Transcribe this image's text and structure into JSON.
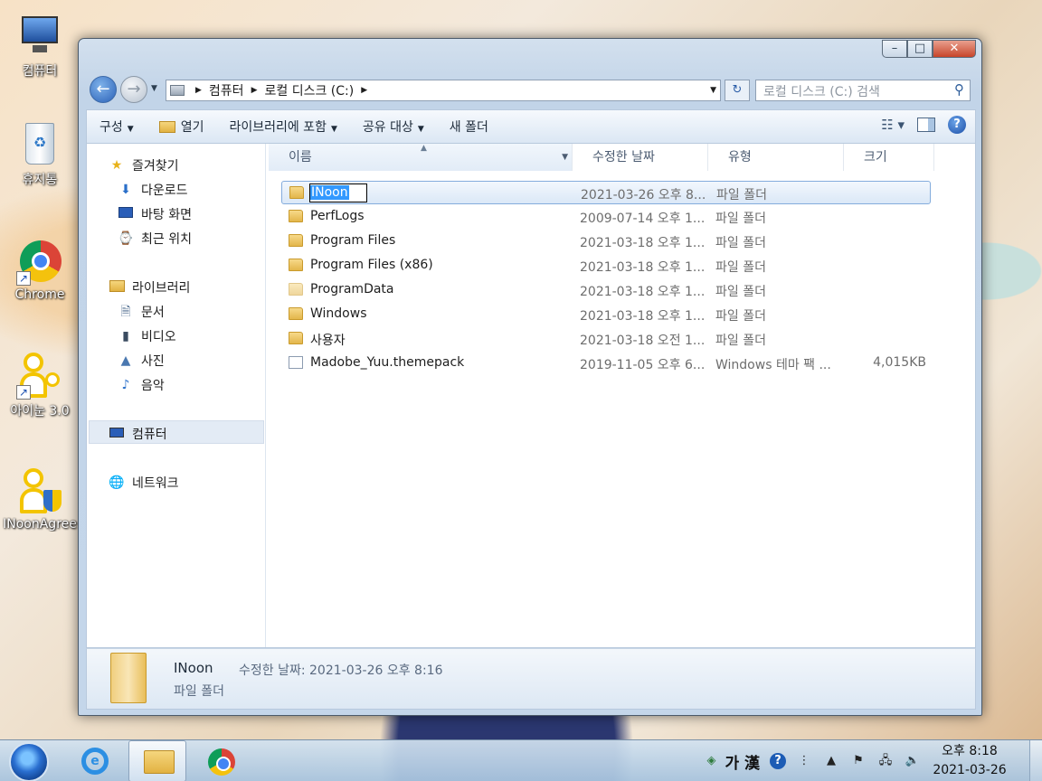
{
  "desktop": {
    "icons": [
      {
        "label": "컴퓨터",
        "icon": "computer-icon"
      },
      {
        "label": "휴지통",
        "icon": "recycle-bin-icon"
      },
      {
        "label": "Chrome",
        "icon": "chrome-icon"
      },
      {
        "label": "아이눈 3.0",
        "icon": "inoon-icon"
      },
      {
        "label": "INoonAgree",
        "icon": "inoon-agree-icon"
      }
    ]
  },
  "window": {
    "caption": {
      "minimize": "–",
      "maximize": "□",
      "close": "✕"
    },
    "address": {
      "crumbs": [
        "컴퓨터",
        "로컬 디스크 (C:)"
      ],
      "search_placeholder": "로컬 디스크 (C:) 검색"
    },
    "toolbar": {
      "organize": "구성",
      "open": "열기",
      "include_library": "라이브러리에 포함",
      "share": "공유 대상",
      "new_folder": "새 폴더"
    },
    "nav": {
      "favorites": "즐겨찾기",
      "downloads": "다운로드",
      "desktop": "바탕 화면",
      "recent": "최근 위치",
      "libraries": "라이브러리",
      "documents": "문서",
      "videos": "비디오",
      "pictures": "사진",
      "music": "음악",
      "computer": "컴퓨터",
      "network": "네트워크"
    },
    "columns": {
      "name": "이름",
      "modified": "수정한 날짜",
      "type": "유형",
      "size": "크기"
    },
    "files": [
      {
        "name": "INoon",
        "modified": "2021-03-26 오후 8...",
        "type": "파일 폴더",
        "size": "",
        "kind": "folder",
        "selected": true,
        "renaming": true
      },
      {
        "name": "PerfLogs",
        "modified": "2009-07-14 오후 1...",
        "type": "파일 폴더",
        "size": "",
        "kind": "folder"
      },
      {
        "name": "Program Files",
        "modified": "2021-03-18 오후 1...",
        "type": "파일 폴더",
        "size": "",
        "kind": "folder"
      },
      {
        "name": "Program Files (x86)",
        "modified": "2021-03-18 오후 1...",
        "type": "파일 폴더",
        "size": "",
        "kind": "folder"
      },
      {
        "name": "ProgramData",
        "modified": "2021-03-18 오후 1...",
        "type": "파일 폴더",
        "size": "",
        "kind": "folder"
      },
      {
        "name": "Windows",
        "modified": "2021-03-18 오후 1...",
        "type": "파일 폴더",
        "size": "",
        "kind": "folder"
      },
      {
        "name": "사용자",
        "modified": "2021-03-18 오전 1...",
        "type": "파일 폴더",
        "size": "",
        "kind": "folder"
      },
      {
        "name": "Madobe_Yuu.themepack",
        "modified": "2019-11-05 오후 6...",
        "type": "Windows 테마 팩 ...",
        "size": "4,015KB",
        "kind": "file"
      }
    ],
    "details": {
      "name": "INoon",
      "meta": "수정한 날짜: 2021-03-26 오후 8:16",
      "type": "파일 폴더"
    }
  },
  "taskbar": {
    "ime": "가 漢",
    "clock_time": "오후 8:18",
    "clock_date": "2021-03-26"
  }
}
